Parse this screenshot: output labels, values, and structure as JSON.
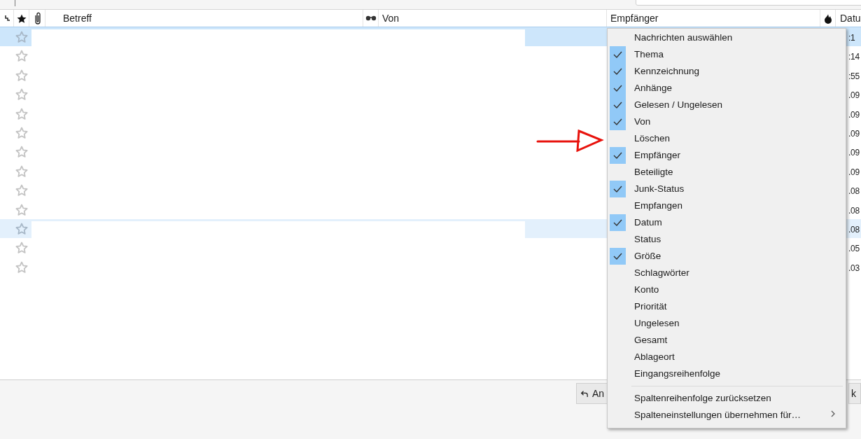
{
  "columns": [
    "Betreff",
    "Von",
    "Empfänger",
    "Datu"
  ],
  "rows": [
    {
      "selected": true,
      "hovered": false,
      "starred": false,
      "date": ":1"
    },
    {
      "selected": false,
      "hovered": false,
      "starred": false,
      "date": ":14"
    },
    {
      "selected": false,
      "hovered": false,
      "starred": false,
      "date": ":55"
    },
    {
      "selected": false,
      "hovered": false,
      "starred": false,
      "date": ".09"
    },
    {
      "selected": false,
      "hovered": false,
      "starred": false,
      "date": ".09"
    },
    {
      "selected": false,
      "hovered": false,
      "starred": false,
      "date": ".09"
    },
    {
      "selected": false,
      "hovered": false,
      "starred": false,
      "date": ".09"
    },
    {
      "selected": false,
      "hovered": false,
      "starred": false,
      "date": ".09"
    },
    {
      "selected": false,
      "hovered": false,
      "starred": false,
      "date": ".08"
    },
    {
      "selected": false,
      "hovered": false,
      "starred": false,
      "date": ".08"
    },
    {
      "selected": false,
      "hovered": true,
      "starred": false,
      "date": ".08"
    },
    {
      "selected": false,
      "hovered": false,
      "starred": false,
      "date": ".05"
    },
    {
      "selected": false,
      "hovered": false,
      "starred": false,
      "date": ".03"
    }
  ],
  "menu": {
    "column_items": [
      {
        "label": "Nachrichten auswählen",
        "checked": false
      },
      {
        "label": "Thema",
        "checked": true
      },
      {
        "label": "Kennzeichnung",
        "checked": true
      },
      {
        "label": "Anhänge",
        "checked": true
      },
      {
        "label": "Gelesen / Ungelesen",
        "checked": true
      },
      {
        "label": "Von",
        "checked": true
      },
      {
        "label": "Löschen",
        "checked": false
      },
      {
        "label": "Empfänger",
        "checked": true
      },
      {
        "label": "Beteiligte",
        "checked": false
      },
      {
        "label": "Junk-Status",
        "checked": true
      },
      {
        "label": "Empfangen",
        "checked": false
      },
      {
        "label": "Datum",
        "checked": true
      },
      {
        "label": "Status",
        "checked": false
      },
      {
        "label": "Größe",
        "checked": true
      },
      {
        "label": "Schlagwörter",
        "checked": false
      },
      {
        "label": "Konto",
        "checked": false
      },
      {
        "label": "Priorität",
        "checked": false
      },
      {
        "label": "Ungelesen",
        "checked": false
      },
      {
        "label": "Gesamt",
        "checked": false
      },
      {
        "label": "Ablageort",
        "checked": false
      },
      {
        "label": "Eingangsreihenfolge",
        "checked": false
      }
    ],
    "actions": [
      {
        "label": "Spaltenreihenfolge zurücksetzen",
        "submenu": false
      },
      {
        "label": "Spalteneinstellungen übernehmen für…",
        "submenu": true
      }
    ]
  },
  "footer_buttons": [
    "An",
    "k"
  ]
}
